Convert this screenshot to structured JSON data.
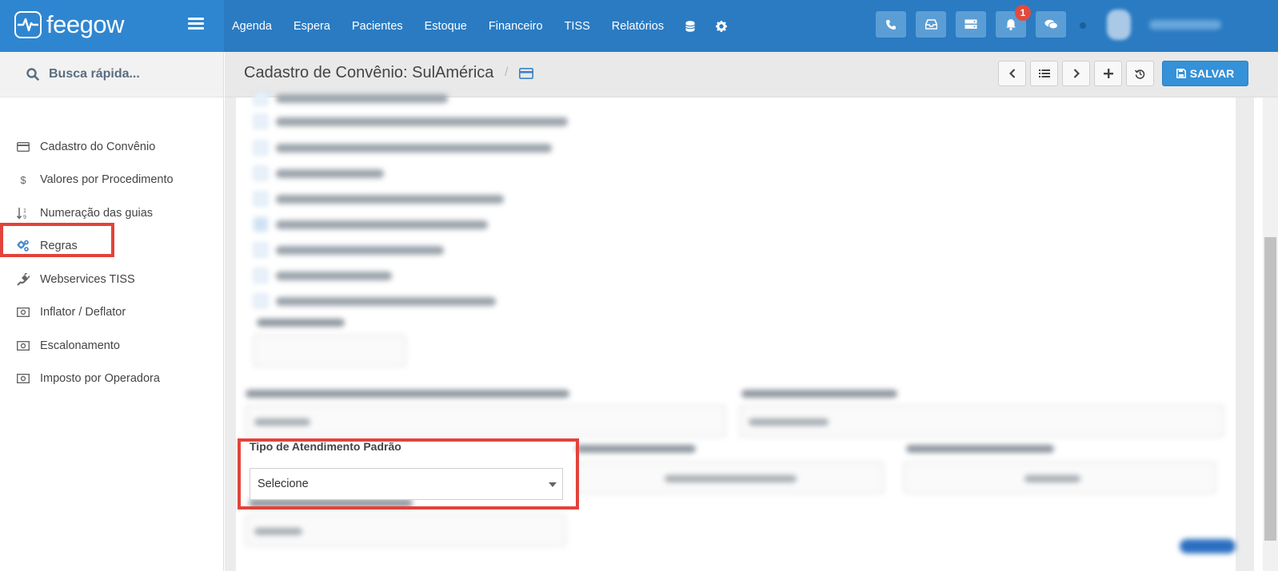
{
  "brand": {
    "name": "feegow"
  },
  "nav": {
    "items": [
      "Agenda",
      "Espera",
      "Pacientes",
      "Estoque",
      "Financeiro",
      "TISS",
      "Relatórios"
    ]
  },
  "top_actions": {
    "notification_count": "1"
  },
  "search": {
    "placeholder": "Busca rápida..."
  },
  "sidebar": {
    "items": [
      {
        "label": "Cadastro do Convênio",
        "icon": "card-icon"
      },
      {
        "label": "Valores por Procedimento",
        "icon": "dollar-icon"
      },
      {
        "label": "Numeração das guias",
        "icon": "sort-numeric-icon"
      },
      {
        "label": "Regras",
        "icon": "cogs-icon"
      },
      {
        "label": "Webservices TISS",
        "icon": "plug-icon"
      },
      {
        "label": "Inflator / Deflator",
        "icon": "money-icon"
      },
      {
        "label": "Escalonamento",
        "icon": "money-icon"
      },
      {
        "label": "Imposto por Operadora",
        "icon": "money-icon"
      }
    ],
    "highlighted": "Regras"
  },
  "header": {
    "title": "Cadastro de Convênio: SulAmérica",
    "separator": "/",
    "save_label": "SALVAR"
  },
  "form": {
    "tipo_atendimento": {
      "label": "Tipo de Atendimento Padrão",
      "value": "Selecione"
    }
  },
  "colors": {
    "topbar": "#2a7bc2",
    "accent": "#3591d8",
    "highlight": "#e2433a"
  }
}
